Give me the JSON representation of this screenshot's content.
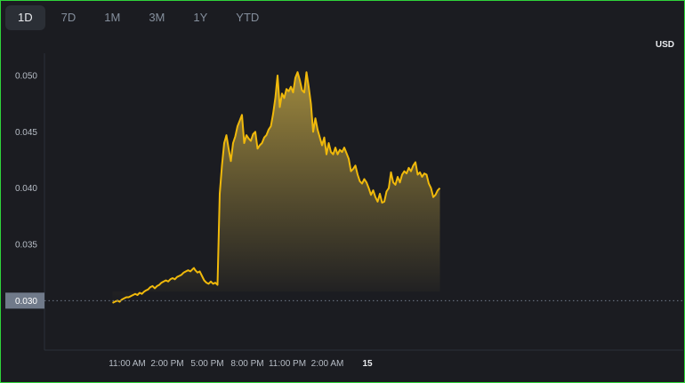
{
  "timeframe_tabs": [
    {
      "label": "1D",
      "active": true
    },
    {
      "label": "7D",
      "active": false
    },
    {
      "label": "1M",
      "active": false
    },
    {
      "label": "3M",
      "active": false
    },
    {
      "label": "1Y",
      "active": false
    },
    {
      "label": "YTD",
      "active": false
    }
  ],
  "currency_label": "USD",
  "colors": {
    "line": "#f0b90b",
    "background": "#1b1c21"
  },
  "current_price_label": "0.030",
  "chart_data": {
    "type": "area",
    "y_ticks": [
      "0.050",
      "0.045",
      "0.040",
      "0.035"
    ],
    "x_ticks": [
      "11:00 AM",
      "2:00 PM",
      "5:00 PM",
      "8:00 PM",
      "11:00 PM",
      "2:00 AM",
      "15"
    ],
    "ylim": [
      0.0278,
      0.052
    ],
    "y_reference": 0.03,
    "x_hours": [
      -3.3,
      -2.8,
      -2.2,
      -1.7,
      -1.2,
      -0.7,
      -0.2,
      0.3,
      0.8,
      1.3,
      1.8,
      2.3,
      2.8,
      3.3,
      3.8,
      4.2,
      4.7,
      5.2,
      5.7,
      6.2,
      6.7,
      7.2,
      7.7,
      8.2,
      8.7,
      9.2,
      9.7,
      10.2,
      10.7,
      11.2,
      11.7,
      12.2,
      12.7,
      13.2,
      13.7,
      14.2,
      14.7,
      15.0,
      15.3,
      15.8,
      16.3,
      16.8,
      17.3,
      17.8,
      18.3,
      18.8,
      19.3,
      19.8,
      20.3,
      20.8,
      21.3,
      21.8,
      22.3,
      22.8,
      23.3,
      23.8,
      24.3,
      24.8,
      25.3,
      25.8,
      26.3,
      26.8,
      27.3,
      27.8,
      28.3,
      28.8,
      29.3,
      29.8,
      30.3,
      30.8,
      31.3,
      31.8,
      32.3,
      32.8,
      33.3,
      33.8,
      34.3,
      34.8,
      35.3,
      35.8,
      36.3,
      36.8,
      37.3,
      37.8,
      38.3,
      38.8,
      39.3,
      39.8,
      40.3,
      40.8,
      41.3,
      41.8,
      42.3,
      42.8,
      43.3,
      43.8,
      44.3,
      44.8,
      45.3,
      45.8,
      46.3,
      46.8,
      47.3,
      47.8,
      48.3,
      48.8,
      49.3,
      49.8,
      50.3,
      50.8,
      51.3,
      51.8,
      52.3,
      52.8,
      53.3,
      53.8,
      54.3,
      54.8,
      55.3,
      55.8,
      56.3,
      56.8,
      57.3,
      57.8,
      58.3,
      58.8,
      59.3,
      59.8,
      60.3,
      60.8,
      61.3,
      61.8,
      62.3,
      62.8,
      63.3,
      63.8,
      64.3,
      64.8,
      65.3,
      65.8,
      66.3,
      66.8,
      67.3,
      67.8,
      68.3,
      68.8,
      69.3,
      69.8,
      70.3,
      70.8,
      71.3,
      71.8,
      72.3
    ],
    "x_tick_hours": [
      0,
      18,
      36,
      54,
      72,
      90,
      108
    ]
  }
}
